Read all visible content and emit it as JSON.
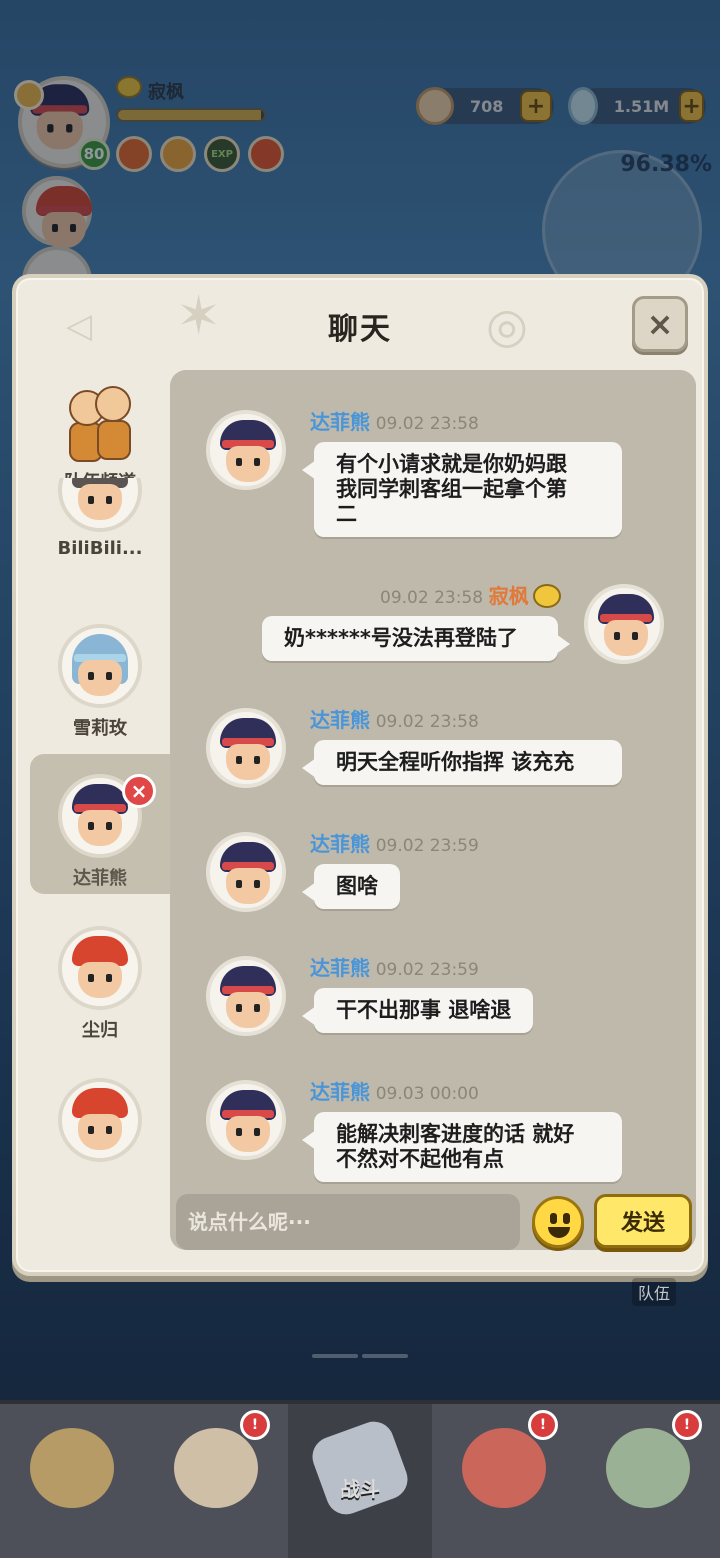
{
  "hud": {
    "player_name": "寂枫",
    "level": "80",
    "exp_fill": 0.98,
    "buff_exp_label": "EXP",
    "pearls": "708",
    "gems": "1.51M",
    "plus": "+",
    "progress": "96.38%"
  },
  "panel": {
    "title": "聊天",
    "close": "×"
  },
  "sidebar": {
    "items": [
      {
        "label": "队伍频道",
        "type": "team"
      },
      {
        "label": "BiliBili...",
        "face": "grey"
      },
      {
        "label": "雪莉玫",
        "face": "blue"
      },
      {
        "label": "达菲熊",
        "face": "dark",
        "active": true
      },
      {
        "label": "尘归",
        "face": "red"
      },
      {
        "label": "",
        "face": "red"
      }
    ],
    "remove": "×"
  },
  "messages": [
    {
      "side": "left",
      "name": "达菲熊",
      "time": "09.02 23:58",
      "text": "有个小请求就是你奶妈跟\n我同学刺客组一起拿个第\n二"
    },
    {
      "side": "right",
      "name": "寂枫",
      "time": "09.02 23:58",
      "text": "奶******号没法再登陆了"
    },
    {
      "side": "left",
      "name": "达菲熊",
      "time": "09.02 23:58",
      "text": "明天全程听你指挥 该充充"
    },
    {
      "side": "left",
      "name": "达菲熊",
      "time": "09.02 23:59",
      "text": "图啥"
    },
    {
      "side": "left",
      "name": "达菲熊",
      "time": "09.02 23:59",
      "text": "干不出那事 退啥退"
    },
    {
      "side": "left",
      "name": "达菲熊",
      "time": "09.03 00:00",
      "text": "能解决刺客进度的话 就好\n不然对不起他有点"
    }
  ],
  "input": {
    "placeholder": "说点什么呢···",
    "send": "发送"
  },
  "queue_label": "队伍",
  "bottom_nav": {
    "tabs": [
      {
        "label": "",
        "icon": "beast-icon",
        "notify": false
      },
      {
        "label": "",
        "icon": "hero-icon",
        "notify": true
      },
      {
        "label": "战斗",
        "icon": "sword-icon",
        "notify": false,
        "active": true
      },
      {
        "label": "",
        "icon": "pet-icon",
        "notify": true
      },
      {
        "label": "",
        "icon": "tribe-icon",
        "notify": true
      }
    ],
    "notify_symbol": "!"
  },
  "colors": {
    "name_other": "#4a95d8",
    "name_self": "#e07a3a",
    "send_button": "#ffe76a",
    "panel_bg": "#eeeadf"
  }
}
